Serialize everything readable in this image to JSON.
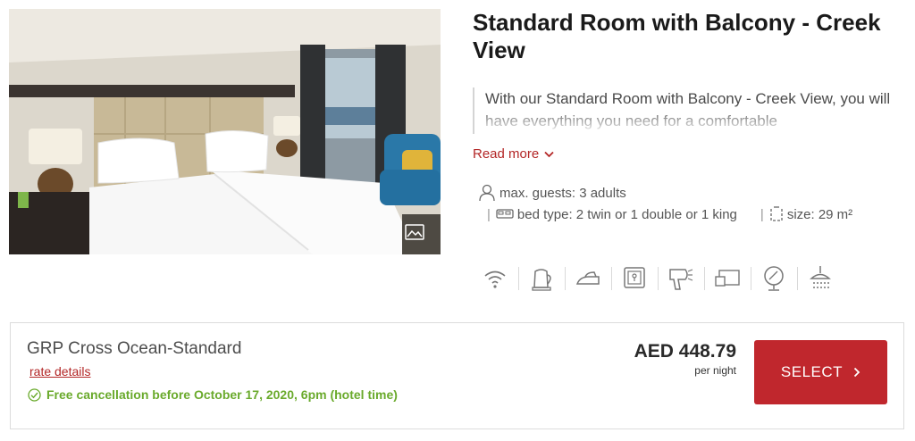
{
  "room": {
    "title": "Standard Room with Balcony - Creek View",
    "description": "With our Standard Room with Balcony - Creek View, you will have everything you need for a comfortable",
    "read_more": "Read more",
    "specs": {
      "guests": "max. guests: 3 adults",
      "bed": "bed type: 2 twin or 1 double or 1 king",
      "size": "size: 29 m²"
    },
    "amenity_icons": [
      "wifi-icon",
      "kettle-icon",
      "iron-icon",
      "safe-icon",
      "hairdryer-icon",
      "tv-icon",
      "mirror-icon",
      "shower-icon"
    ]
  },
  "rate": {
    "name": "GRP Cross Ocean-Standard",
    "details_link": "rate details",
    "cancellation": "Free cancellation before October 17, 2020, 6pm (hotel time)",
    "price": "AED 448.79",
    "price_unit": "per night",
    "select_label": "SELECT"
  },
  "colors": {
    "accent": "#c0272d",
    "link": "#b32626",
    "success": "#6aaa2c"
  }
}
